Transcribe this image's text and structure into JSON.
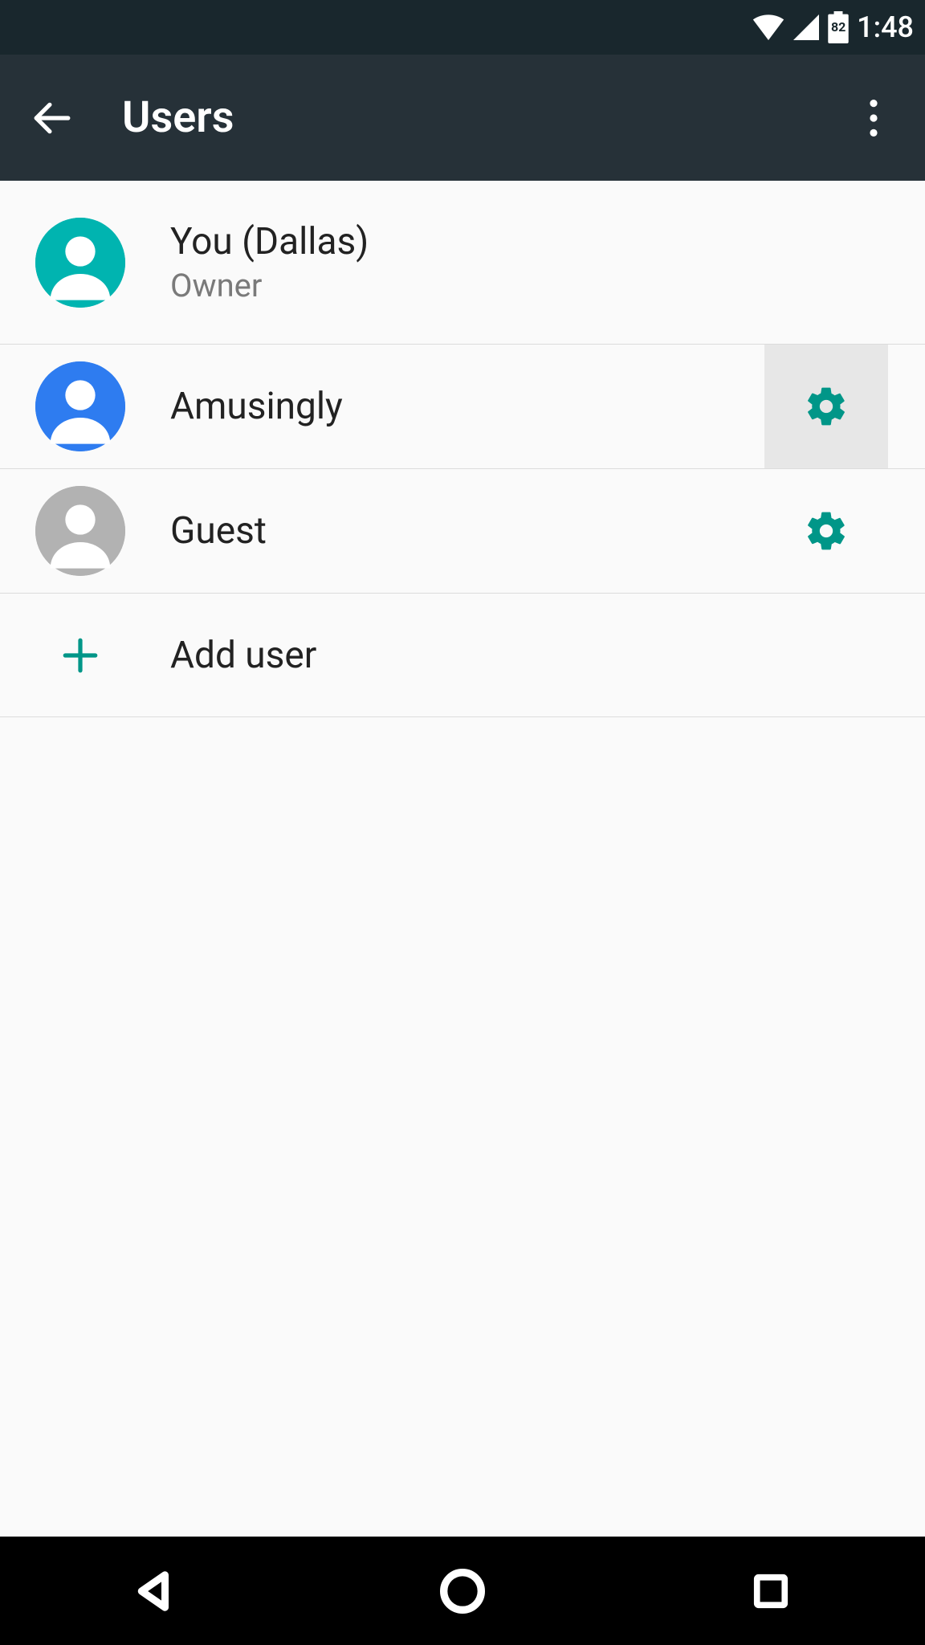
{
  "colors": {
    "teal": "#00b4b0",
    "blue": "#2e7cf0",
    "grey": "#b2b2b2",
    "accent": "#009688"
  },
  "status": {
    "battery_pct": "82",
    "time": "1:48"
  },
  "appbar": {
    "title": "Users"
  },
  "users": {
    "owner": {
      "name": "You (Dallas)",
      "role": "Owner"
    },
    "u1": {
      "name": "Amusingly"
    },
    "u2": {
      "name": "Guest"
    }
  },
  "add": {
    "label": "Add user"
  }
}
